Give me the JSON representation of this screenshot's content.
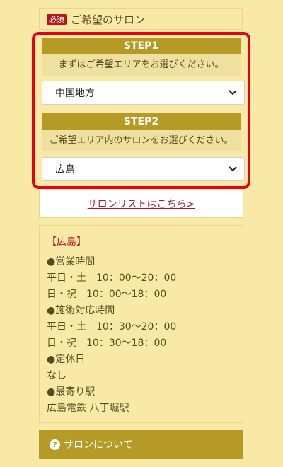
{
  "header": {
    "badge": "必須",
    "title": "ご希望のサロン"
  },
  "step1": {
    "label": "STEP1",
    "description": "まずはご希望エリアをお選びください。",
    "selected": "中国地方"
  },
  "step2": {
    "label": "STEP2",
    "description": "ご希望エリア内のサロンをお選びください。",
    "selected": "広島"
  },
  "salon_list_link": "サロンリストはこちら>",
  "info": {
    "title": "【広島】",
    "lines": [
      "●営業時間",
      "平日・土　10：00〜20：00",
      "日・祝　10：00〜18：00",
      "●施術対応時間",
      "平日・土　10：30〜20：00",
      "日・祝　10：30〜18：00",
      "●定休日",
      "なし",
      "●最寄り駅",
      "広島電鉄 八丁堀駅"
    ]
  },
  "about": {
    "icon": "question-circle-icon",
    "icon_glyph": "?",
    "label": "サロンについて"
  },
  "colors": {
    "background": "#f8eaa6",
    "accent": "#b59b26",
    "highlight_border": "#e50012",
    "link": "#9b2236"
  }
}
